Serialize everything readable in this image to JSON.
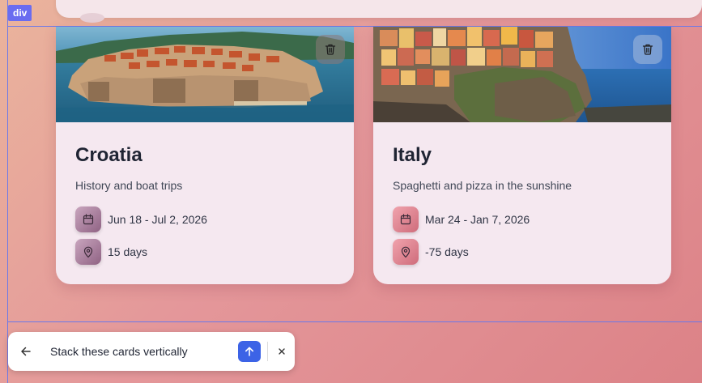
{
  "selection": {
    "tag_label": "div",
    "color": "#6a6cf0"
  },
  "cards": [
    {
      "title": "Croatia",
      "description": "History and boat trips",
      "dates": "Jun 18 - Jul 2, 2026",
      "duration": "15 days",
      "image_icon": "landscape-image",
      "delete_icon": "trash-icon"
    },
    {
      "title": "Italy",
      "description": "Spaghetti and pizza in the sunshine",
      "dates": "Mar 24 - Jan 7, 2026",
      "duration": "-75 days",
      "image_icon": "landscape-image",
      "delete_icon": "trash-icon"
    }
  ],
  "prompt": {
    "value": "Stack these cards vertically",
    "send_color": "#3c63e6"
  }
}
